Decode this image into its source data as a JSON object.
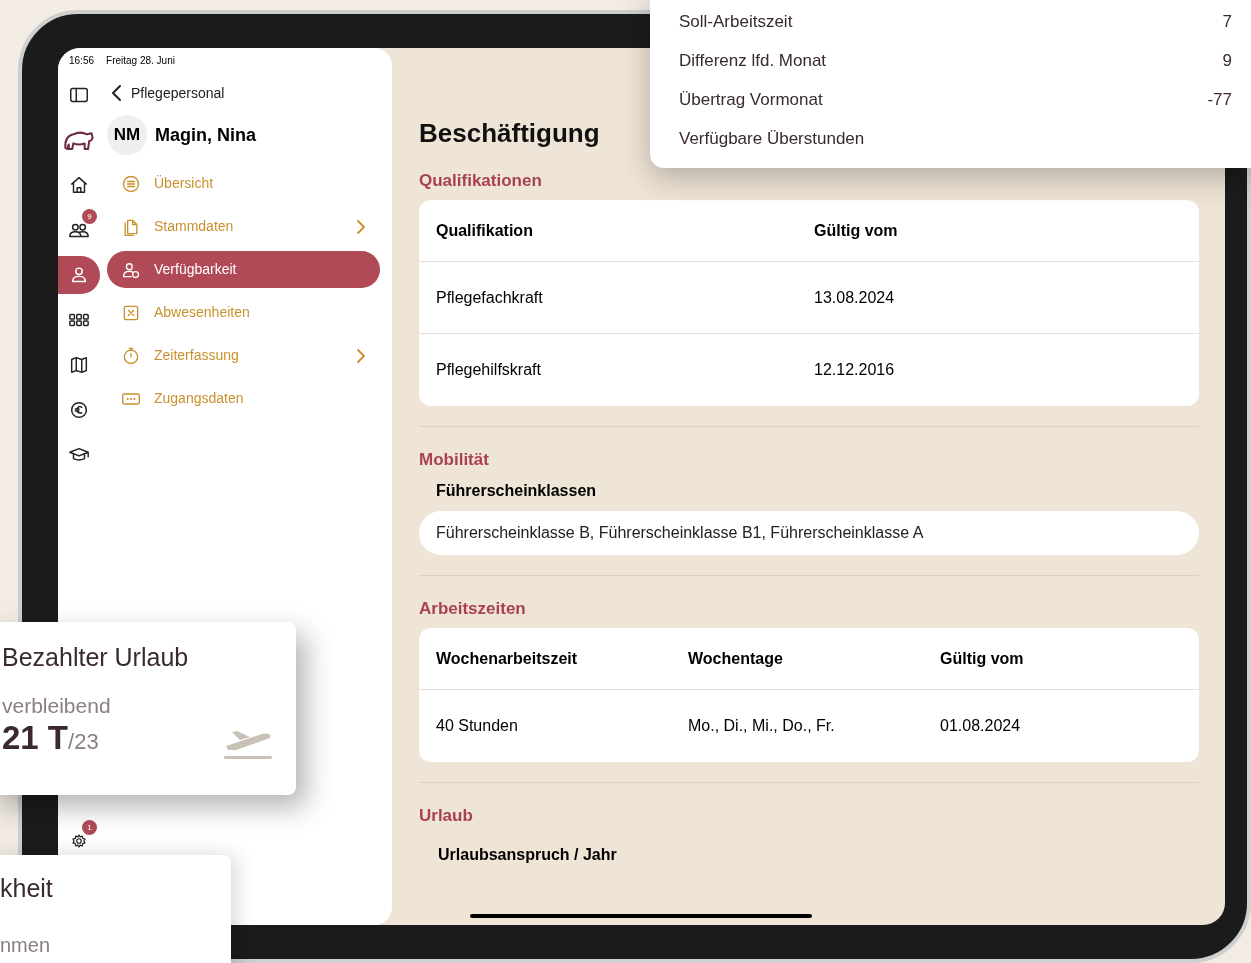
{
  "status_bar": {
    "time": "16:56",
    "date": "Freitag 28. Juni"
  },
  "rail": [
    {
      "kind": "panel",
      "selected": false
    },
    {
      "kind": "logo",
      "selected": false
    },
    {
      "kind": "home",
      "selected": false
    },
    {
      "kind": "people",
      "selected": false,
      "badge": "9"
    },
    {
      "kind": "person",
      "selected": true
    },
    {
      "kind": "grid",
      "selected": false
    },
    {
      "kind": "map",
      "selected": false
    },
    {
      "kind": "euro",
      "selected": false
    },
    {
      "kind": "education",
      "selected": false
    },
    {
      "kind": "settings",
      "selected": false,
      "badge": "1"
    }
  ],
  "nav": {
    "back_label": "Pflegepersonal",
    "initials": "NM",
    "name": "Magin, Nina"
  },
  "menu": [
    {
      "kind": "list",
      "label": "Übersicht",
      "selected": false,
      "submenu": false
    },
    {
      "kind": "documents",
      "label": "Stammdaten",
      "selected": false,
      "submenu": true
    },
    {
      "kind": "person",
      "label": "Verfügbarkeit",
      "selected": true,
      "submenu": false
    },
    {
      "kind": "cross",
      "label": "Abwesenheiten",
      "selected": false,
      "submenu": false
    },
    {
      "kind": "timer",
      "label": "Zeiterfassung",
      "selected": false,
      "submenu": true
    },
    {
      "kind": "password",
      "label": "Zugangsdaten",
      "selected": false,
      "submenu": false
    }
  ],
  "page_title": "Beschäftigung",
  "sections": [
    {
      "kind": "table",
      "title": "Qualifikationen",
      "columns": [
        "Qualifikation",
        "Gültig vom"
      ],
      "rows": [
        [
          "Pflegefachkraft",
          "13.08.2024"
        ],
        [
          "Pflegehilfskraft",
          "12.12.2016"
        ]
      ]
    },
    {
      "kind": "field",
      "title": "Mobilität",
      "label": "Führerscheinklassen",
      "value": "Führerscheinklasse B, Führerscheinklasse B1, Führerscheinklasse A"
    },
    {
      "kind": "table",
      "title": "Arbeitszeiten",
      "columns": [
        "Wochenarbeitszeit",
        "Wochentage",
        "Gültig vom"
      ],
      "rows": [
        [
          "40 Stunden",
          "Mo., Di., Mi., Do., Fr.",
          "01.08.2024"
        ]
      ]
    },
    {
      "kind": "label",
      "title": "Urlaub",
      "label": "Urlaubsanspruch / Jahr"
    }
  ],
  "hours_card": {
    "rows": [
      {
        "label": "Soll-Arbeitszeit",
        "value": "7"
      },
      {
        "label": "Differenz lfd. Monat",
        "value": "9"
      },
      {
        "label": "Übertrag Vormonat",
        "value": "-77"
      },
      {
        "label": "Verfügbare Überstunden",
        "value": ""
      }
    ]
  },
  "vacation_card": {
    "title": "Bezahlter Urlaub",
    "caption": "verbleibend",
    "value": "21",
    "unit": "T",
    "total": "/23"
  },
  "third_card": {
    "title": "kheit",
    "caption": "nmen"
  }
}
